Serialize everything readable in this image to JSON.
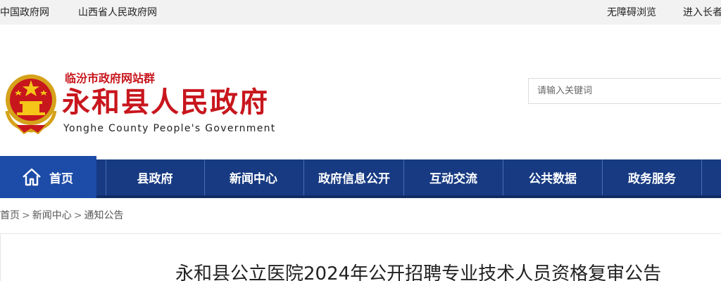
{
  "topbar": {
    "left_links": [
      "中国政府网",
      "山西省人民政府网"
    ],
    "right_links": [
      "无障碍浏览",
      "进入长者"
    ]
  },
  "header": {
    "site_group": "临汾市政府网站群",
    "title": "永和县人民政府",
    "subtitle_en": "Yonghe County People's Government",
    "emblem_icon": "national-emblem-icon",
    "search_placeholder": "请输入关键词"
  },
  "nav": {
    "home_label": "首页",
    "home_icon": "home-icon",
    "items": [
      "县政府",
      "新闻中心",
      "政府信息公开",
      "互动交流",
      "公共数据",
      "政务服务"
    ]
  },
  "breadcrumb": [
    "首页",
    "新闻中心",
    "通知公告"
  ],
  "breadcrumb_sep": ">",
  "article": {
    "title": "永和县公立医院2024年公开招聘专业技术人员资格复审公告"
  },
  "colors": {
    "brand_red": "#c8161d",
    "nav_blue": "#173a82",
    "nav_home_blue": "#1c4ba8",
    "topbar_bg": "#f2f2f2"
  }
}
